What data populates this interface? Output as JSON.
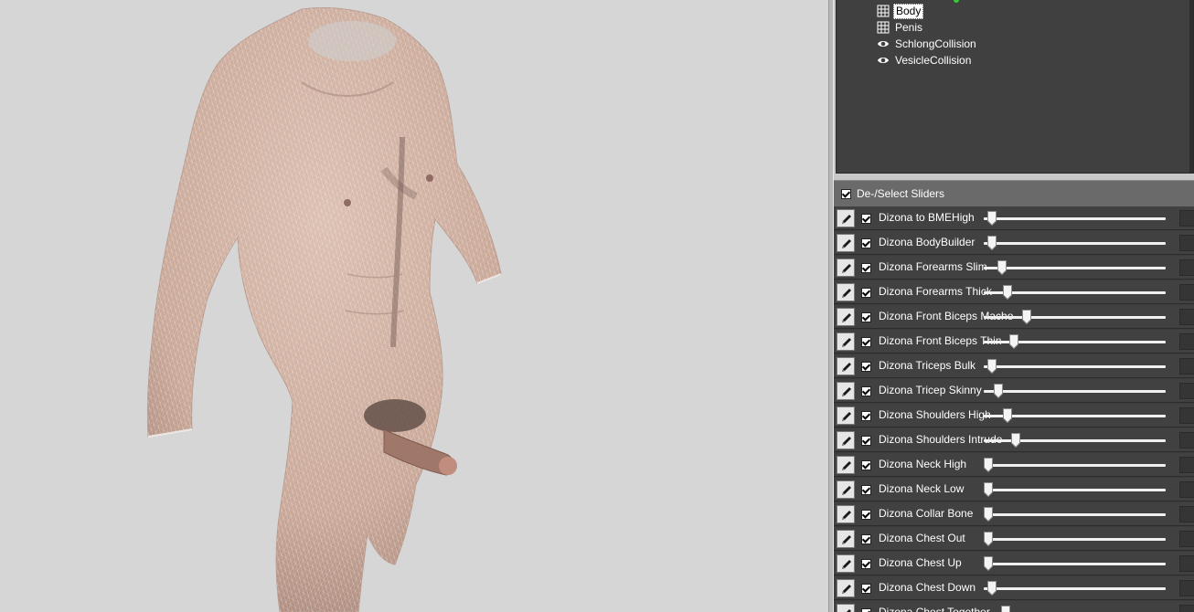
{
  "mesh_tree": {
    "items": [
      {
        "label": "Body",
        "icon": "mesh-grid-icon",
        "selected": true
      },
      {
        "label": "Penis",
        "icon": "mesh-grid-icon",
        "selected": false
      },
      {
        "label": "SchlongCollision",
        "icon": "eye-icon",
        "selected": false
      },
      {
        "label": "VesicleCollision",
        "icon": "eye-icon",
        "selected": false
      }
    ]
  },
  "sliders_header": {
    "label": "De-/Select Sliders",
    "checked": true
  },
  "sliders": [
    {
      "name": "Dizona to BMEHigh",
      "value": 0.02,
      "checked": true
    },
    {
      "name": "Dizona BodyBuilder",
      "value": 0.02,
      "checked": true
    },
    {
      "name": "Dizona Forearms Slim",
      "value": 0.08,
      "checked": true
    },
    {
      "name": "Dizona Forearms Thick",
      "value": 0.11,
      "checked": true
    },
    {
      "name": "Dizona Front Biceps Macho",
      "value": 0.22,
      "checked": true
    },
    {
      "name": "Dizona Front Biceps Thin",
      "value": 0.15,
      "checked": true
    },
    {
      "name": "Dizona Triceps Bulk",
      "value": 0.02,
      "checked": true
    },
    {
      "name": "Dizona Tricep Skinny",
      "value": 0.06,
      "checked": true
    },
    {
      "name": "Dizona Shoulders High",
      "value": 0.11,
      "checked": true
    },
    {
      "name": "Dizona Shoulders Intrude",
      "value": 0.16,
      "checked": true
    },
    {
      "name": "Dizona Neck High",
      "value": 0.0,
      "checked": true
    },
    {
      "name": "Dizona Neck Low",
      "value": 0.0,
      "checked": true
    },
    {
      "name": "Dizona Collar Bone",
      "value": 0.0,
      "checked": true
    },
    {
      "name": "Dizona Chest Out",
      "value": 0.0,
      "checked": true
    },
    {
      "name": "Dizona Chest Up",
      "value": 0.0,
      "checked": true
    },
    {
      "name": "Dizona Chest Down",
      "value": 0.02,
      "checked": true
    },
    {
      "name": "Dizona Chest Together",
      "value": 0.1,
      "checked": true
    }
  ],
  "colors": {
    "viewport_bg": "#d6d6d6",
    "skin": "#d6b4a4",
    "panel_dark": "#404040",
    "tree_indicator": "#2fd02f"
  }
}
